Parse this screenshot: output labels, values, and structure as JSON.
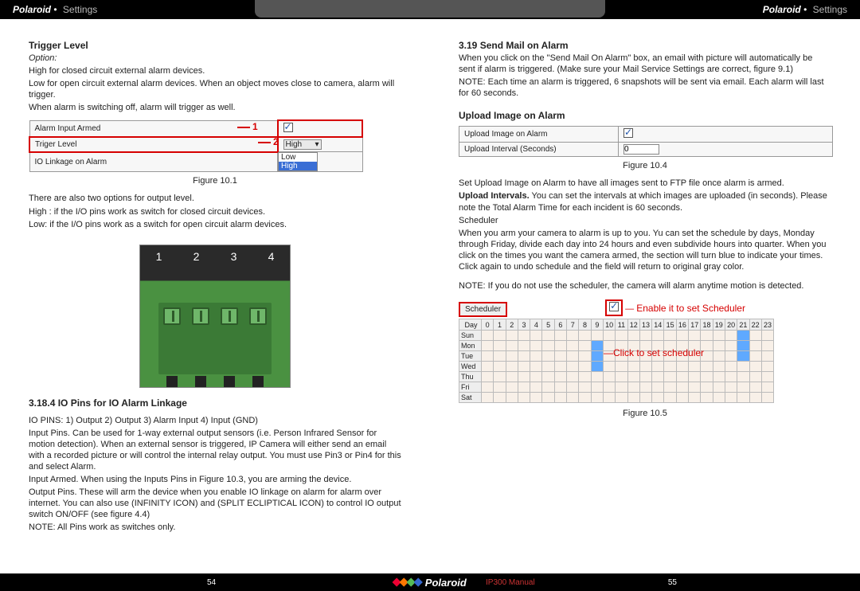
{
  "header": {
    "brand": "Polaroid",
    "section": "Settings"
  },
  "left": {
    "h_trigger": "Trigger Level",
    "option_label": "Option:",
    "p1": "High for closed circuit external alarm devices.",
    "p2": "Low for open circuit external alarm devices. When an object moves close to camera, alarm will trigger.",
    "p3": "When alarm is switching off, alarm will trigger as well.",
    "fig101": {
      "r1": "Alarm Input Armed",
      "r2": "Triger Level",
      "r3": "IO Linkage on Alarm",
      "sel": "High",
      "opt_low": "Low",
      "opt_high": "High",
      "n1": "1",
      "n2": "2",
      "caption": "Figure 10.1"
    },
    "p4": "There are also two options for output level.",
    "p5": "High : if the I/O pins work as switch for closed circuit devices.",
    "p6": "Low: if the I/O pins work as a switch for open circuit alarm devices.",
    "photo_nums": [
      "1",
      "2",
      "3",
      "4"
    ],
    "h_io": "3.18.4 IO Pins for IO Alarm Linkage",
    "p7": "IO PINS: 1) Output 2) Output 3) Alarm Input 4) Input (GND)",
    "p8": "Input Pins. Can be used for 1-way external output sensors (i.e. Person Infrared Sensor for motion detection). When an external sensor is triggered, IP Camera will either send an email with a recorded picture or will control the internal relay output. You must use Pin3 or Pin4 for this and select Alarm.",
    "p9": "Input Armed. When using the Inputs Pins in Figure 10.3, you are arming the device.",
    "p10": "Output Pins. These will arm the device when you enable IO linkage on alarm for alarm over internet. You can also use (INFINITY ICON) and (SPLIT ECLIPTICAL ICON) to control IO output switch ON/OFF (see figure 4.4)",
    "p11": "NOTE: All Pins work as switches only."
  },
  "right": {
    "h_send": "3.19 Send Mail on Alarm",
    "p1": "When you click on the \"Send Mail On Alarm\" box, an email with picture will automatically be sent if alarm is triggered. (Make sure your Mail Service Settings are correct, figure 9.1)",
    "p2": "NOTE: Each time an alarm is triggered, 6 snapshots will be sent via email. Each alarm will last for 60 seconds.",
    "h_upload": "Upload Image on Alarm",
    "fig104": {
      "r1": "Upload Image on Alarm",
      "r2": "Upload Interval (Seconds)",
      "val": "0",
      "caption": "Figure 10.4"
    },
    "p3": "Set Upload Image on Alarm to have all images sent to FTP file once alarm is armed.",
    "p4a": "Upload Intervals.",
    "p4b": " You can set the intervals at which images are uploaded (in seconds). Please note the Total Alarm Time for each incident is 60 seconds.",
    "p5": "Scheduler",
    "p6": "When you arm your camera to alarm is up to you. Yu can set the schedule by days, Monday through Friday, divide each day into 24 hours and even subdivide hours into quarter. When you click on the times you want the camera armed, the section will turn blue to indicate your times. Click again to undo schedule and the field will return to original gray color.",
    "p7": "NOTE: If you do not use the scheduler, the camera will alarm anytime motion is detected.",
    "sched": {
      "btn": "Scheduler",
      "enable": "Enable it to set Scheduler",
      "click": "Click to set scheduler",
      "day": "Day",
      "hrs": [
        "0",
        "1",
        "2",
        "3",
        "4",
        "5",
        "6",
        "7",
        "8",
        "9",
        "10",
        "11",
        "12",
        "13",
        "14",
        "15",
        "16",
        "17",
        "18",
        "19",
        "20",
        "21",
        "22",
        "23"
      ],
      "rows": [
        "Sun",
        "Mon",
        "Tue",
        "Wed",
        "Thu",
        "Fri",
        "Sat"
      ],
      "caption": "Figure 10.5"
    }
  },
  "footer": {
    "page_left": "54",
    "logo": "Polaroid",
    "manual": "IP300 Manual",
    "page_right": "55"
  }
}
